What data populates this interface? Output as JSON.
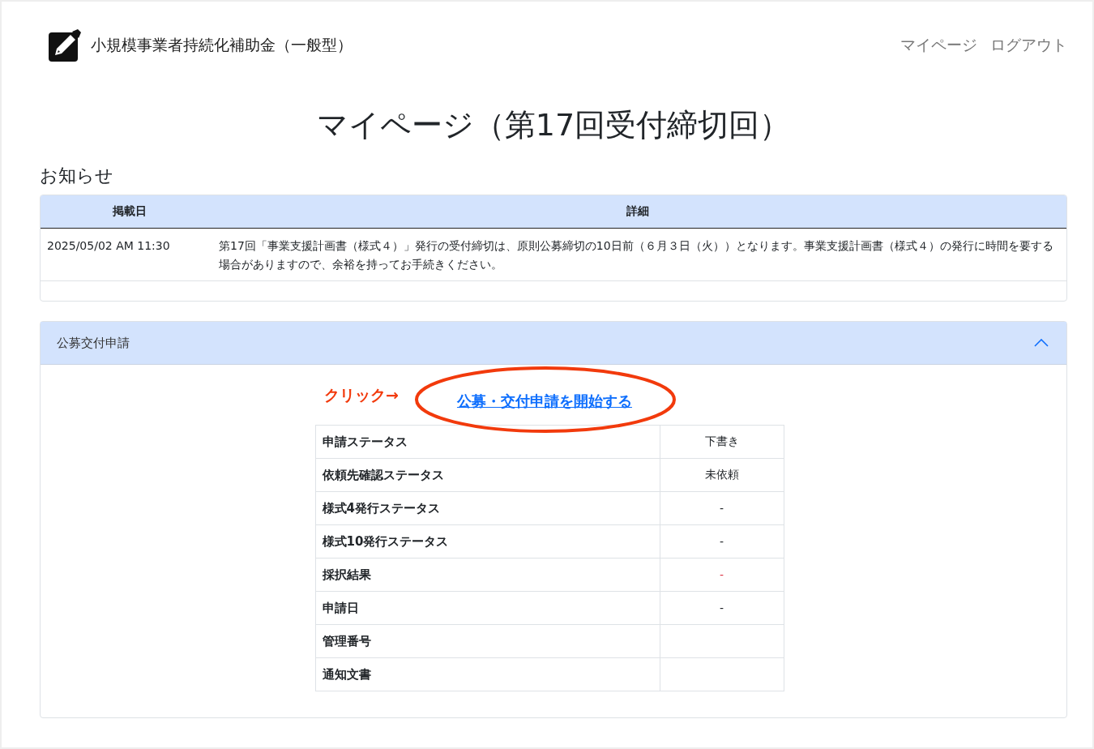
{
  "header": {
    "site_title": "小規模事業者持続化補助金（一般型）",
    "nav": [
      "マイページ",
      "ログアウト"
    ]
  },
  "page_title": "マイページ（第17回受付締切回）",
  "notices": {
    "heading": "お知らせ",
    "columns": [
      "掲載日",
      "詳細"
    ],
    "rows": [
      {
        "date": "2025/05/02 AM 11:30",
        "detail": "第17回「事業支援計画書（様式４）」発行の受付締切は、原則公募締切の10日前（６月３日（火））となります。事業支援計画書（様式４）の発行に時間を要する場合がありますので、余裕を持ってお手続きください。"
      }
    ]
  },
  "application": {
    "title": "公募交付申請",
    "expanded": true,
    "annotation": "クリック→",
    "start_link": "公募・交付申請を開始する",
    "status_rows": [
      {
        "label": "申請ステータス",
        "value": "下書き",
        "color": "#212529"
      },
      {
        "label": "依頼先確認ステータス",
        "value": "未依頼",
        "color": "#212529"
      },
      {
        "label": "様式4発行ステータス",
        "value": "-",
        "color": "#212529"
      },
      {
        "label": "様式10発行ステータス",
        "value": "-",
        "color": "#212529"
      },
      {
        "label": "採択結果",
        "value": "-",
        "color": "#dc3545"
      },
      {
        "label": "申請日",
        "value": "-",
        "color": "#212529"
      },
      {
        "label": "管理番号"
      },
      {
        "label": "通知文書"
      }
    ]
  }
}
